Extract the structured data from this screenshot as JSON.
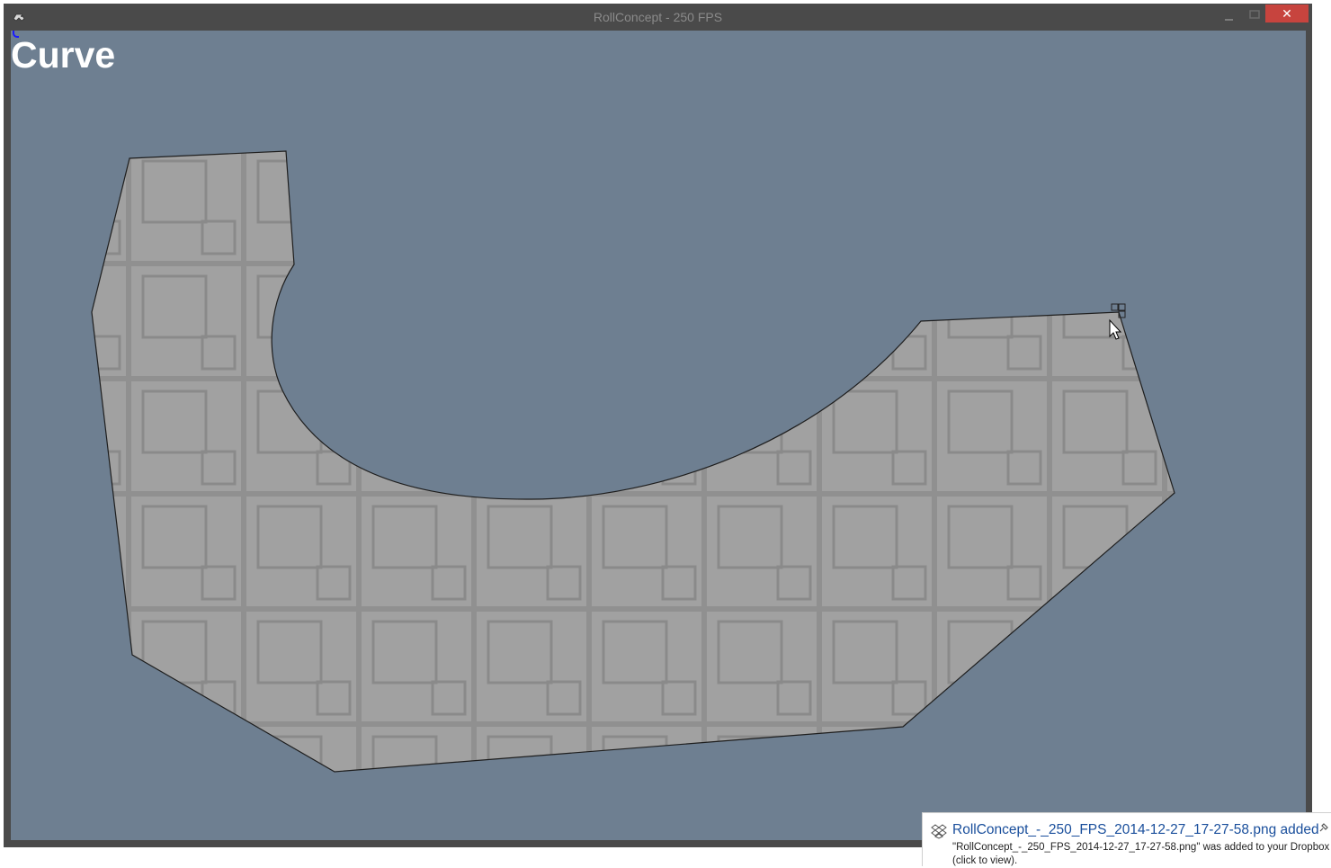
{
  "window": {
    "title": "RollConcept - 250 FPS",
    "close_label": "✕",
    "icons": {
      "app": "gamepad-icon",
      "minimize": "minimize-icon",
      "maximize": "maximize-icon",
      "close": "close-icon"
    }
  },
  "canvas": {
    "heading": "Curve",
    "background_color": "#6e7f91",
    "shape_fill_color": "#a0a0a0"
  },
  "notification": {
    "title": "RollConcept_-_250_FPS_2014-12-27_17-27-58.png added",
    "body_line1": "\"RollConcept_-_250_FPS_2014-12-27_17-27-58.png\" was added to your Dropbox",
    "body_line2": "(click to view).",
    "icon": "dropbox-icon",
    "title_color": "#1a4f9c"
  },
  "colors": {
    "close_button": "#c7443e",
    "window_frame": "#4a4a4a"
  }
}
